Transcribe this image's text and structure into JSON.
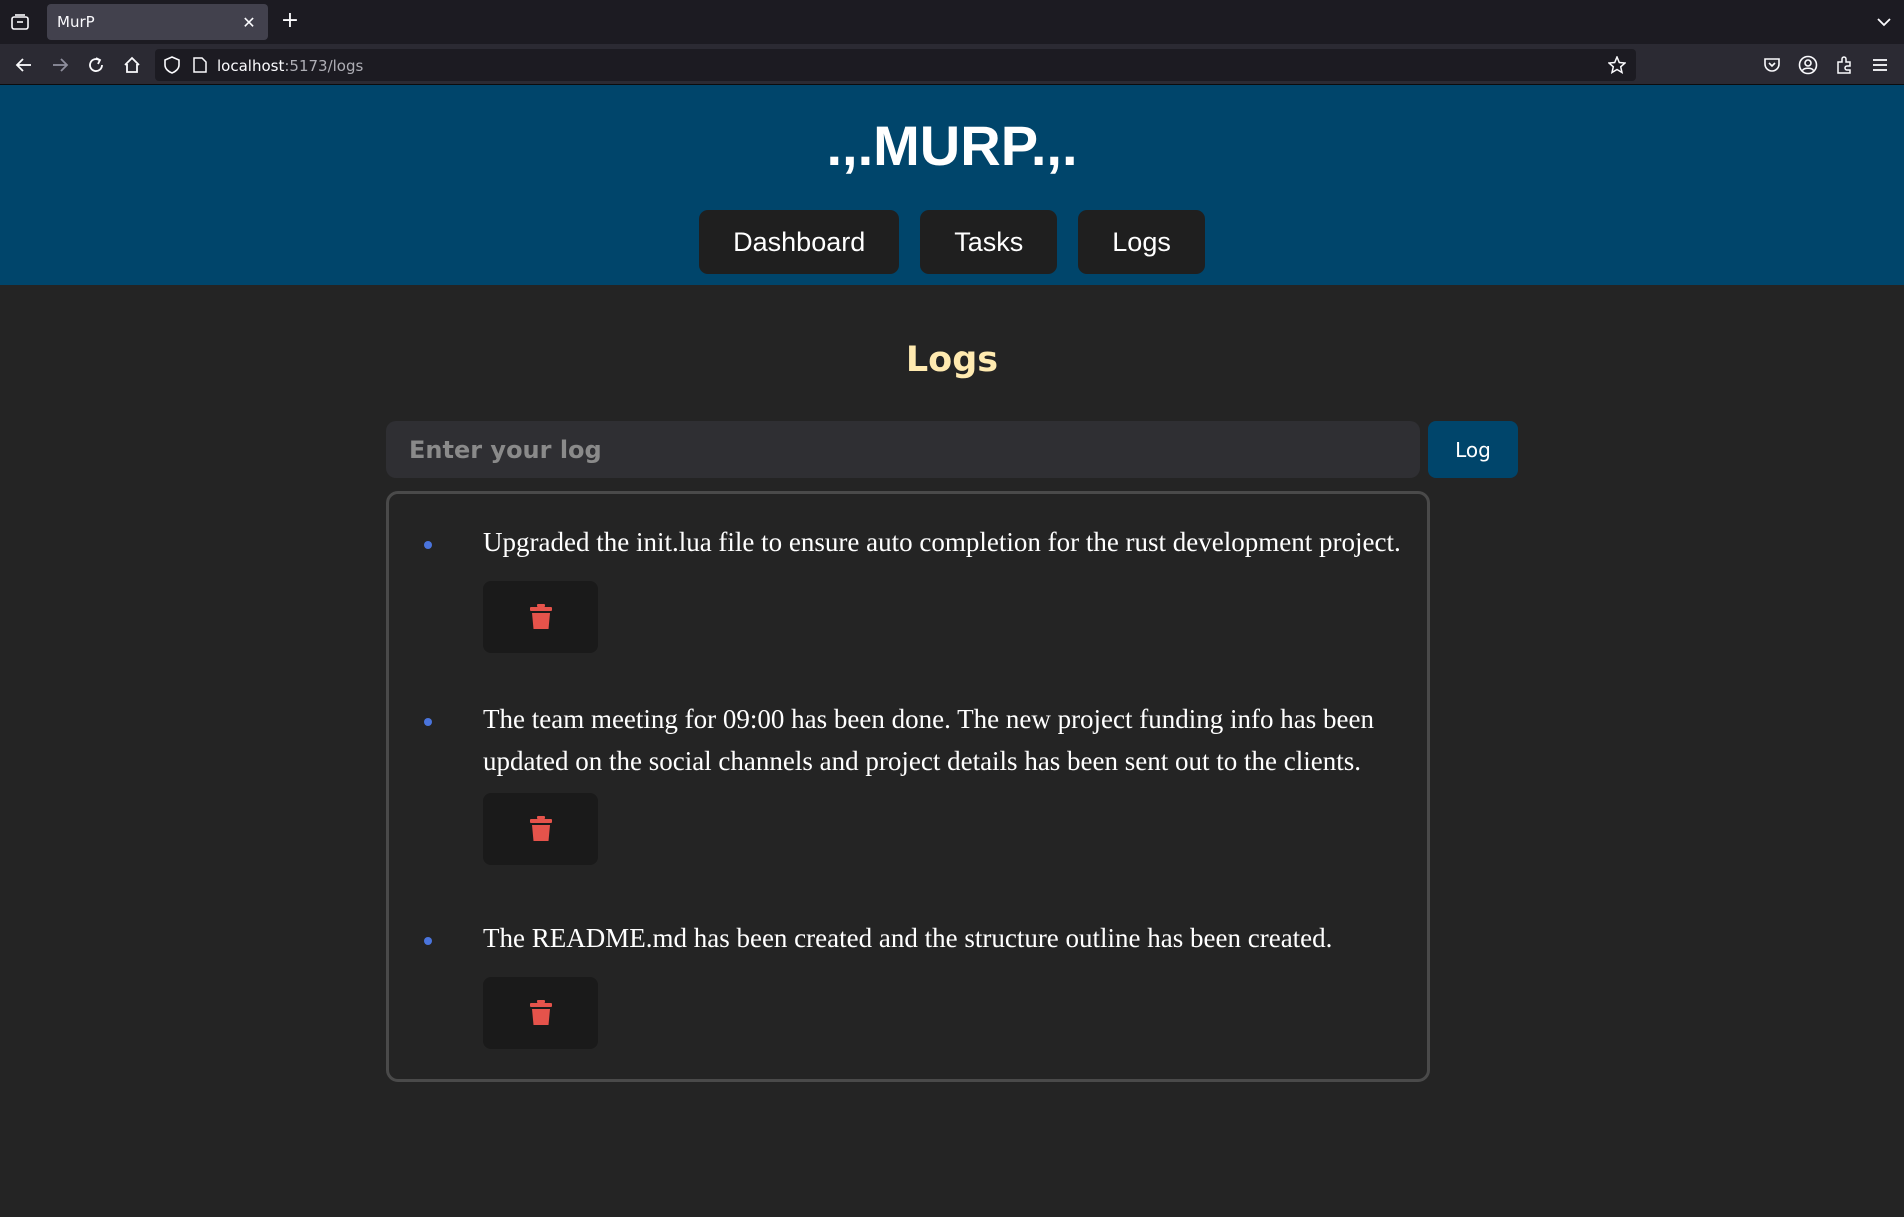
{
  "browser": {
    "tab_title": "MurP",
    "url_host": "localhost",
    "url_path": ":5173/logs"
  },
  "app": {
    "brand": ".,.MURP.,.",
    "nav": [
      "Dashboard",
      "Tasks",
      "Logs"
    ]
  },
  "main": {
    "title": "Logs",
    "input_placeholder": "Enter your log",
    "log_button": "Log",
    "logs": [
      "Upgraded the init.lua file to ensure auto completion for the rust development project.",
      "The team meeting for 09:00 has been done. The new project funding info has been updated on the social channels and project details has been sent out to the clients.",
      "The README.md has been created and the structure outline has been created."
    ]
  },
  "colors": {
    "header_bg": "#00456b",
    "title_color": "#ffeab0",
    "bullet": "#4a74dc",
    "trash": "#e5534b"
  },
  "icons": [
    "tab-list-icon",
    "close-icon",
    "plus-icon",
    "chevron-down-icon",
    "back-icon",
    "forward-icon",
    "reload-icon",
    "home-icon",
    "shield-icon",
    "page-icon",
    "star-icon",
    "pocket-icon",
    "account-icon",
    "extensions-icon",
    "menu-icon",
    "trash-icon"
  ]
}
